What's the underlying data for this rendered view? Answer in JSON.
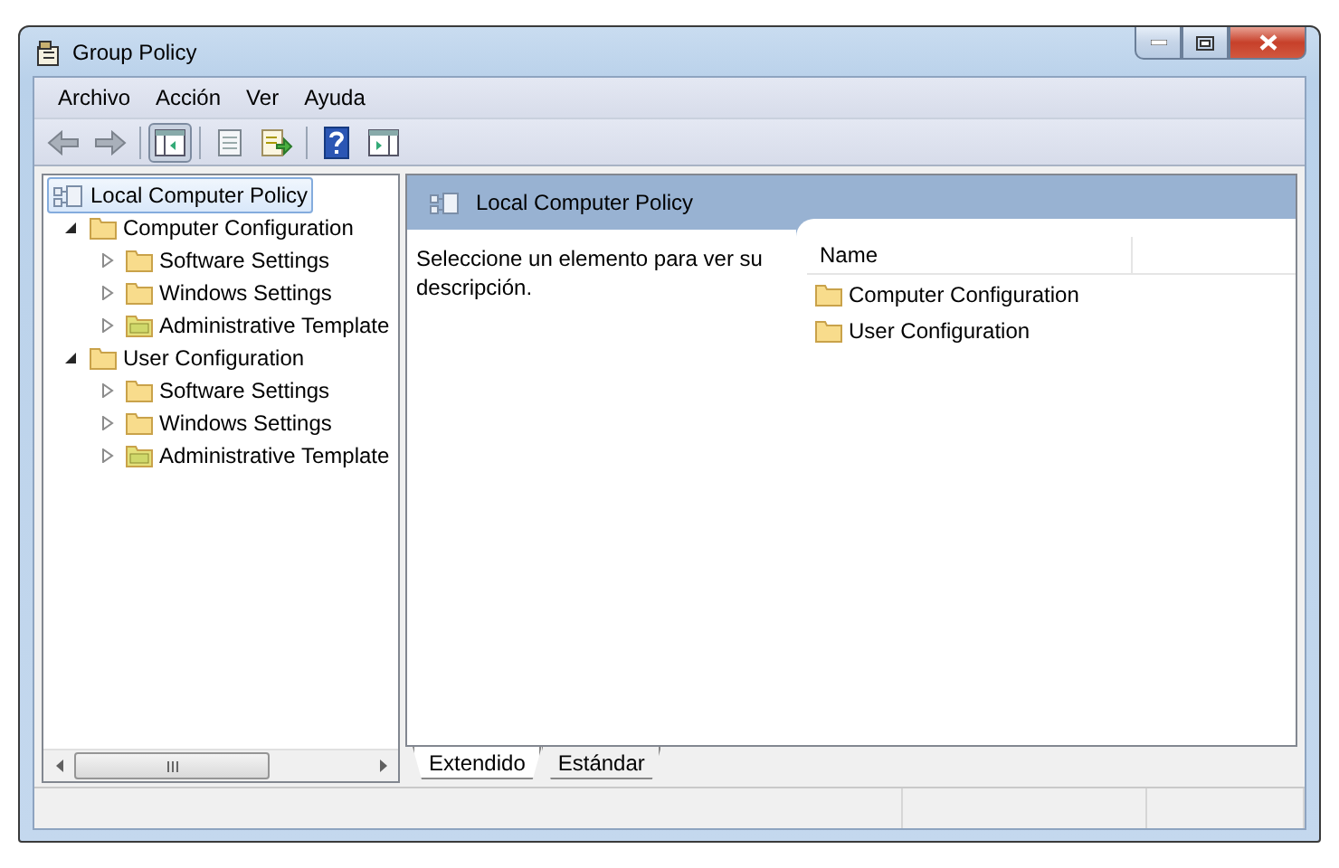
{
  "window": {
    "title": "Group Policy"
  },
  "menu": [
    "Archivo",
    "Acción",
    "Ver",
    "Ayuda"
  ],
  "toolbar": [
    {
      "kind": "back",
      "pressed": false
    },
    {
      "kind": "forward",
      "pressed": false
    },
    {
      "kind": "sep"
    },
    {
      "kind": "tree",
      "pressed": true
    },
    {
      "kind": "sep"
    },
    {
      "kind": "properties",
      "pressed": false
    },
    {
      "kind": "export",
      "pressed": false
    },
    {
      "kind": "sep"
    },
    {
      "kind": "help",
      "pressed": false
    },
    {
      "kind": "actionpane",
      "pressed": false
    }
  ],
  "tree": [
    {
      "label": "Local Computer Policy",
      "selected": true,
      "kind": "root",
      "children": [
        {
          "label": "Computer Configuration",
          "selected": false,
          "kind": "folder",
          "expanded": true,
          "children": [
            {
              "label": "Software Settings",
              "selected": false,
              "kind": "folder",
              "expanded": false
            },
            {
              "label": "Windows Settings",
              "selected": false,
              "kind": "folder",
              "expanded": false
            },
            {
              "label": "Administrative Template",
              "selected": false,
              "kind": "template",
              "expanded": false
            }
          ]
        },
        {
          "label": "User Configuration",
          "selected": false,
          "kind": "folder",
          "expanded": true,
          "children": [
            {
              "label": "Software Settings",
              "selected": false,
              "kind": "folder",
              "expanded": false
            },
            {
              "label": "Windows Settings",
              "selected": false,
              "kind": "folder",
              "expanded": false
            },
            {
              "label": "Administrative Template",
              "selected": false,
              "kind": "template",
              "expanded": false
            }
          ]
        }
      ]
    }
  ],
  "detail": {
    "title": "Local Computer Policy",
    "description": "Seleccione un elemento para ver su descripción.",
    "columns": [
      "Name"
    ],
    "rows": [
      "Computer Configuration",
      "User Configuration"
    ]
  },
  "tabs": [
    {
      "label": "Extendido",
      "selected": true
    },
    {
      "label": "Estándar",
      "selected": false
    }
  ]
}
